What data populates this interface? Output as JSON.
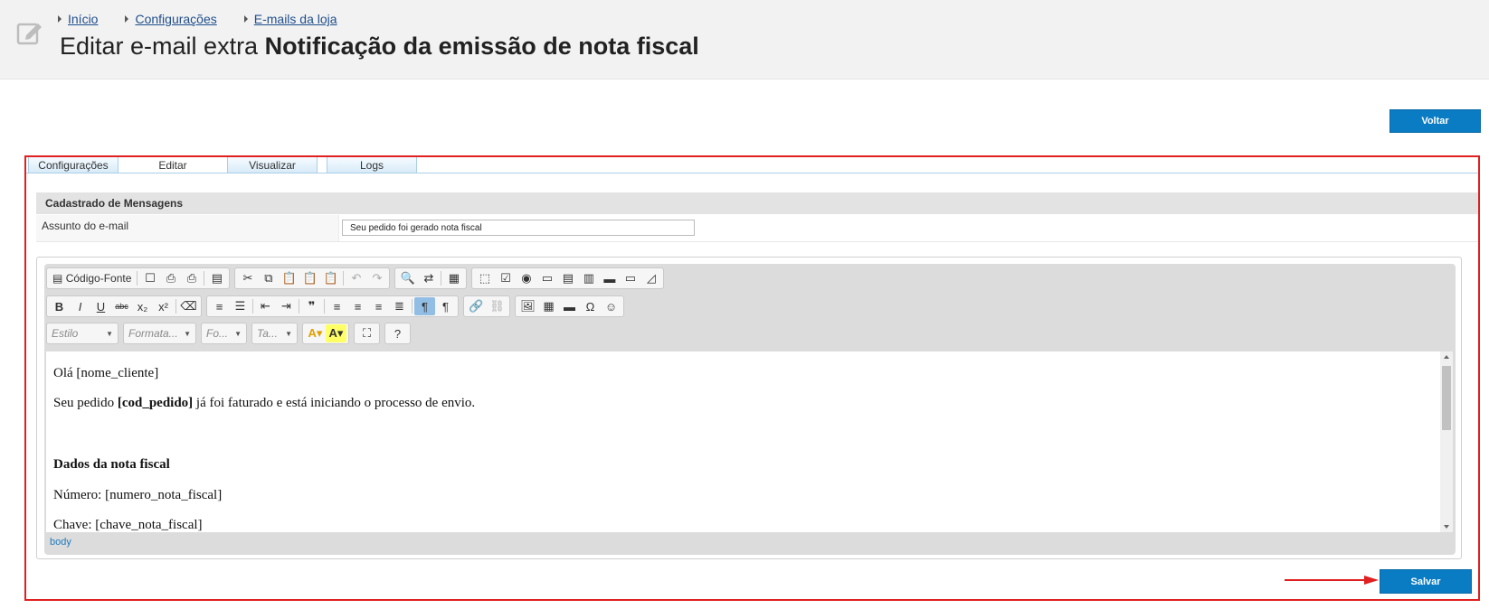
{
  "breadcrumb": [
    "Início",
    "Configurações",
    "E-mails da loja"
  ],
  "page": {
    "title_prefix": "Editar e-mail extra",
    "title_name": "Notificação da emissão de nota fiscal"
  },
  "buttons": {
    "back": "Voltar",
    "save": "Salvar"
  },
  "tabs": [
    "Configurações",
    "Editar",
    "Visualizar",
    "Logs"
  ],
  "active_tab": "Editar",
  "section": {
    "title": "Cadastrado de Mensagens"
  },
  "form": {
    "subject_label": "Assunto do e-mail",
    "subject_value": "Seu pedido foi gerado nota fiscal"
  },
  "toolbar": {
    "source_label": "Código-Fonte",
    "combos": [
      "Estilo",
      "Formata...",
      "Fo...",
      "Ta..."
    ]
  },
  "editor": {
    "greeting": "Olá [nome_cliente]",
    "line2_before": "Seu pedido ",
    "line2_bold": "[cod_pedido]",
    "line2_after": " já foi faturado e está iniciando o processo de envio.",
    "heading": "Dados da nota fiscal",
    "number": "Número: [numero_nota_fiscal]",
    "key": "Chave: [chave_nota_fiscal]",
    "status_path": "body"
  },
  "colors": {
    "primary": "#0a7cc3",
    "highlight": "#e02020",
    "tab_border": "#a9cfe9"
  }
}
